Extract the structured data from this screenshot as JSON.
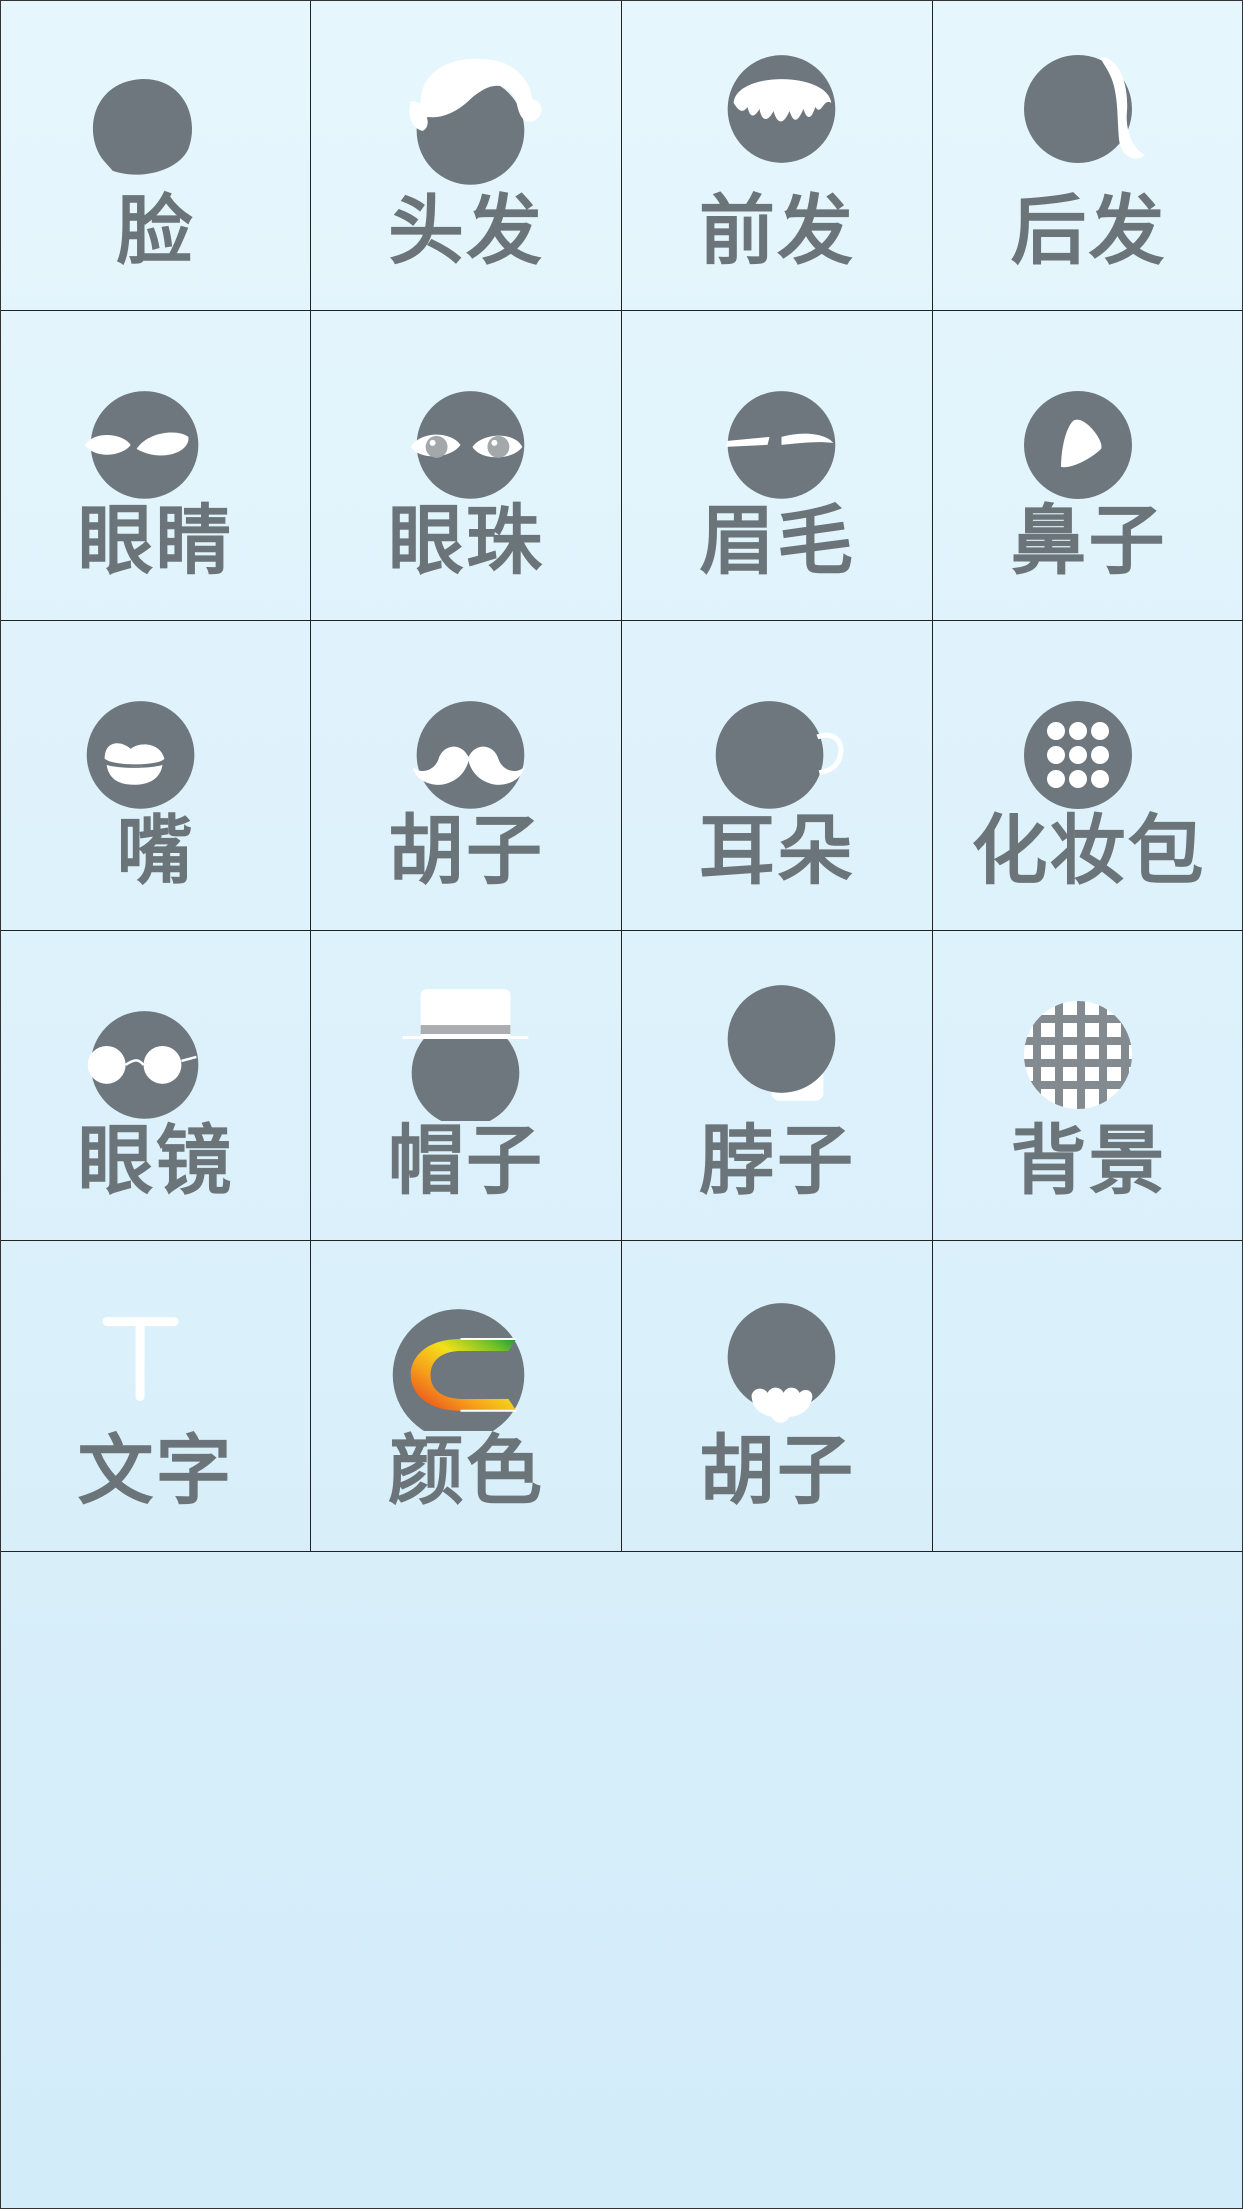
{
  "tiles": [
    {
      "label": "脸",
      "icon": "face-icon"
    },
    {
      "label": "头发",
      "icon": "hair-icon"
    },
    {
      "label": "前发",
      "icon": "front-hair-icon"
    },
    {
      "label": "后发",
      "icon": "back-hair-icon"
    },
    {
      "label": "眼睛",
      "icon": "eyes-icon"
    },
    {
      "label": "眼珠",
      "icon": "eyeballs-icon"
    },
    {
      "label": "眉毛",
      "icon": "eyebrows-icon"
    },
    {
      "label": "鼻子",
      "icon": "nose-icon"
    },
    {
      "label": "嘴",
      "icon": "mouth-icon"
    },
    {
      "label": "胡子",
      "icon": "mustache-icon"
    },
    {
      "label": "耳朵",
      "icon": "ear-icon"
    },
    {
      "label": "化妆包",
      "icon": "makeup-bag-icon"
    },
    {
      "label": "眼镜",
      "icon": "glasses-icon"
    },
    {
      "label": "帽子",
      "icon": "hat-icon"
    },
    {
      "label": "脖子",
      "icon": "neck-icon"
    },
    {
      "label": "背景",
      "icon": "background-icon"
    },
    {
      "label": "文字",
      "icon": "text-icon"
    },
    {
      "label": "颜色",
      "icon": "color-icon"
    },
    {
      "label": "胡子",
      "icon": "beard-icon"
    },
    {
      "label": "",
      "icon": ""
    }
  ],
  "colors": {
    "icon_gray": "#6e777d",
    "label_gray": "#6b7479",
    "accent_white": "#ffffff"
  }
}
